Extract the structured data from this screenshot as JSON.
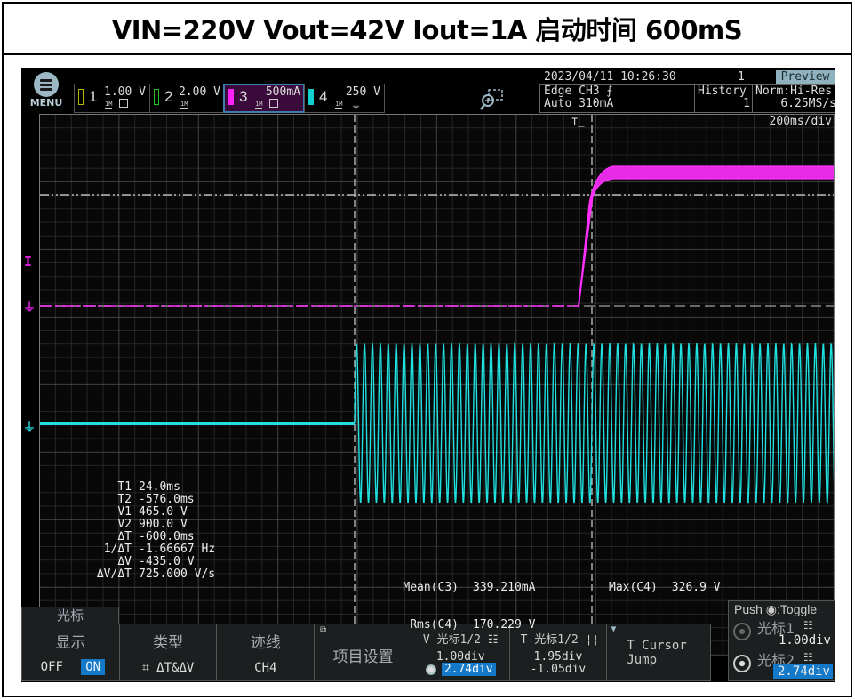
{
  "caption": "VIN=220V Vout=42V Iout=1A  启动时间 600mS",
  "menu": {
    "label": "MENU"
  },
  "channels": [
    {
      "num": "1",
      "scale": "1.00 V",
      "color": "#b8b800",
      "selected": false
    },
    {
      "num": "2",
      "scale": "2.00 V",
      "color": "#20c020",
      "selected": false
    },
    {
      "num": "3",
      "scale": "500mA",
      "color": "#ff20ff",
      "selected": true
    },
    {
      "num": "4",
      "scale": "250 V",
      "color": "#10d0d0",
      "selected": false
    }
  ],
  "channel_impedance": "1M",
  "status": {
    "datetime": "2023/04/11 10:26:30",
    "acq_count": "1",
    "mode_badge": "Preview",
    "trigger_line1": "Edge CH3 ⨍",
    "trigger_line2": "Auto 310mA",
    "history_label": "History",
    "history_value": "1",
    "acq_mode": "Norm:Hi-Res",
    "sample_rate": "6.25MS/s",
    "timebase": "200ms/div"
  },
  "icons": {
    "zoom": "zoom-in-icon",
    "menu": "hamburger-menu-icon",
    "trigger_pos": "trigger-position-icon",
    "ground": "ground-icon",
    "trigger_level": "trigger-level-icon"
  },
  "cursor_readout": [
    {
      "key": "T1",
      "value": "24.0ms"
    },
    {
      "key": "T2",
      "value": "-576.0ms"
    },
    {
      "key": "V1",
      "value": "465.0 V"
    },
    {
      "key": "V2",
      "value": "900.0 V"
    },
    {
      "key": "ΔT",
      "value": "-600.0ms"
    },
    {
      "key": "1/ΔT",
      "value": "-1.66667 Hz"
    },
    {
      "key": "ΔV",
      "value": "-435.0 V"
    },
    {
      "key": "ΔV/ΔT",
      "value": "725.000 V/s"
    }
  ],
  "measurements": {
    "left": [
      {
        "key": "Mean(C3)",
        "value": "339.210mA"
      },
      {
        "key": "Rms(C4)",
        "value": "170.229 V"
      }
    ],
    "right": [
      {
        "key": "Max(C4)",
        "value": "326.9 V"
      }
    ]
  },
  "softkey_menu": {
    "tab": "光标",
    "display": {
      "label": "显示",
      "off": "OFF",
      "on": "ON",
      "state": "ON"
    },
    "type": {
      "label": "类型",
      "value": "⌗ ΔT&ΔV"
    },
    "trace": {
      "label": "迹线",
      "value": "CH4"
    },
    "item_settings": {
      "label": "项目设置"
    },
    "v_cursor": {
      "label": "V 光标1/2",
      "val1": "1.00div",
      "val2": "2.74div"
    },
    "t_cursor": {
      "label": "T 光标1/2",
      "val1": "1.95div",
      "val2": "-1.05div"
    },
    "t_jump": {
      "line1": "T Cursor",
      "line2": "Jump"
    }
  },
  "jog_panel": {
    "hint": "Push ◉:Toggle",
    "cursor1_label": "光标1",
    "cursor1_value": "1.00div",
    "cursor2_label": "光标2",
    "cursor2_value": "2.74div",
    "active": "cursor2"
  },
  "waveforms": {
    "ch3_color": "#ff30ff",
    "ch4_color": "#20e0e0",
    "ch3_description": "Output current: flat at 0 until ~-576ms, rises to ~1A steady state",
    "ch4_description": "Input AC voltage: 0 until ~-1.05div, then ~50Hz sine ±326.9V"
  }
}
